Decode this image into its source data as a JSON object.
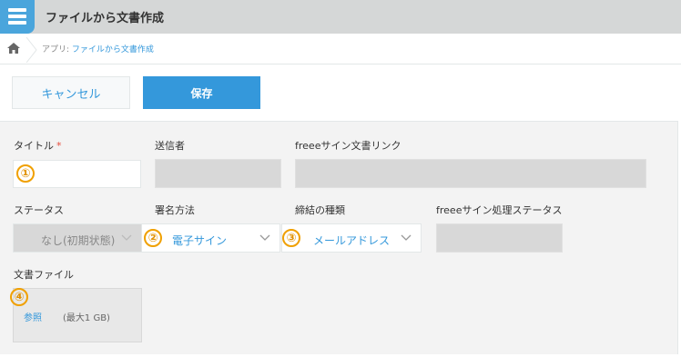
{
  "header": {
    "title": "ファイルから文書作成",
    "app_icon": "list-icon"
  },
  "breadcrumb": {
    "app_prefix": "アプリ:",
    "app_name": "ファイルから文書作成",
    "home_icon": "home-icon"
  },
  "toolbar": {
    "cancel_label": "キャンセル",
    "save_label": "保存"
  },
  "form": {
    "title_label": "タイトル",
    "required_mark": "*",
    "title_value": "",
    "sender_label": "送信者",
    "link_label": "freeeサイン文書リンク",
    "status_label": "ステータス",
    "status_value": "なし(初期状態)",
    "sign_method_label": "署名方法",
    "sign_method_value": "電子サイン",
    "contract_type_label": "締結の種類",
    "contract_type_value": "メールアドレス",
    "process_status_label": "freeeサイン処理ステータス",
    "file_label": "文書ファイル",
    "browse_label": "参照",
    "max_size_label": "(最大1 GB)"
  },
  "markers": [
    "①",
    "②",
    "③",
    "④"
  ],
  "colors": {
    "accent": "#3498db",
    "marker": "#f0a000",
    "required": "#e74c3c"
  }
}
